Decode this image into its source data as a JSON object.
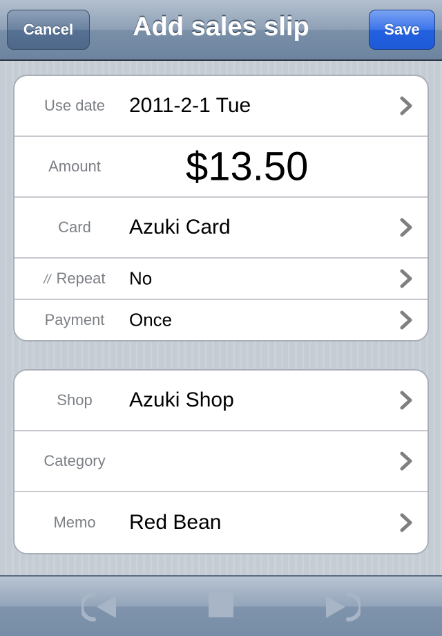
{
  "navbar": {
    "title": "Add sales slip",
    "cancel_label": "Cancel",
    "save_label": "Save"
  },
  "slip": {
    "use_date": {
      "label": "Use date",
      "value": "2011-2-1 Tue"
    },
    "amount": {
      "label": "Amount",
      "value": "$13.50"
    },
    "card": {
      "label": "Card",
      "value": "Azuki Card"
    },
    "repeat": {
      "label": "Repeat",
      "value": "No"
    },
    "payment": {
      "label": "Payment",
      "value": "Once"
    }
  },
  "details": {
    "shop": {
      "label": "Shop",
      "value": "Azuki Shop"
    },
    "category": {
      "label": "Category",
      "value": ""
    },
    "memo": {
      "label": "Memo",
      "value": "Red Bean"
    }
  },
  "toolbar": {
    "icons": [
      "previous-icon",
      "stop-icon",
      "next-icon"
    ]
  },
  "colors": {
    "save_accent": "#2261e0",
    "navbar": "#7a8fa8"
  }
}
